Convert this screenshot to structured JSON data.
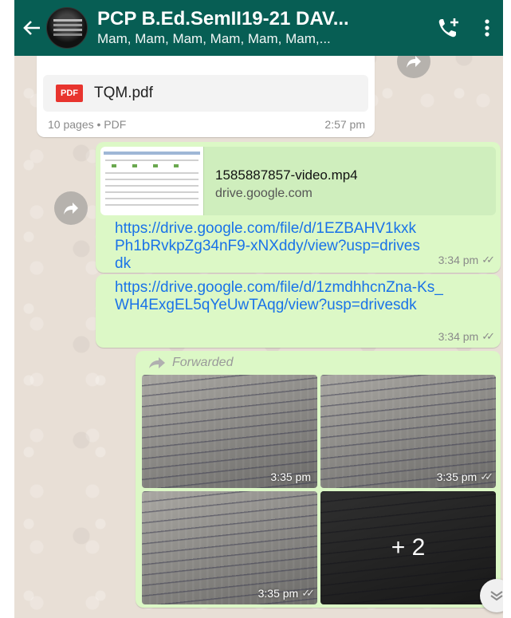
{
  "header": {
    "title": "PCP B.Ed.SemII19-21 DAV...",
    "subtitle": "Mam, Mam, Mam, Mam, Mam, Mam,..."
  },
  "messages": {
    "pdf": {
      "file_name": "TQM.pdf",
      "file_icon_label": "PDF",
      "meta": "10 pages • PDF",
      "time": "2:57 pm"
    },
    "link1": {
      "preview_title": "1585887857-video.mp4",
      "preview_domain": "drive.google.com",
      "url": "https://drive.google.com/file/d/1EZBAHV1kxkPh1bRvkpZg34nF9-xNXddy/view?usp=drivesdk",
      "time": "3:34 pm"
    },
    "link2": {
      "url": "https://drive.google.com/file/d/1zmdhhcnZna-Ks_WH4ExgEL5qYeUwTAqg/view?usp=drivesdk",
      "time": "3:34 pm"
    },
    "media": {
      "forwarded_label": "Forwarded",
      "photos": [
        {
          "time": "3:35 pm"
        },
        {
          "time": "3:35 pm"
        },
        {
          "time": "3:35 pm"
        }
      ],
      "more_count": "+ 2"
    }
  },
  "colors": {
    "header": "#075e54",
    "incoming": "#ffffff",
    "outgoing": "#dcf8c6",
    "link": "#1a73e8"
  }
}
